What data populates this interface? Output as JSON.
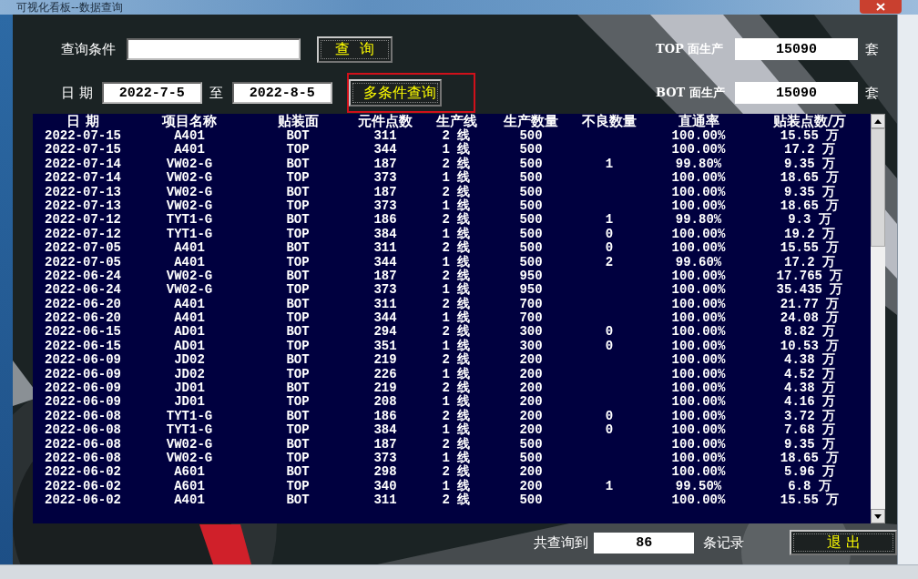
{
  "window": {
    "title": "可视化看板--数据查询"
  },
  "query": {
    "label": "查询条件",
    "button": "查  询"
  },
  "date_range": {
    "label": "日 期",
    "from": "2022-7-5",
    "separator": "至",
    "to": "2022-8-5",
    "button": "多条件查询"
  },
  "production": [
    {
      "label": "TOP 面生产",
      "value": "15090",
      "unit": "套"
    },
    {
      "label": "BOT 面生产",
      "value": "15090",
      "unit": "套"
    }
  ],
  "table": {
    "columns": [
      "日 期",
      "项目名称",
      "贴装面",
      "元件点数",
      "生产线",
      "生产数量",
      "不良数量",
      "直通率",
      "贴装点数/万"
    ],
    "rows": [
      {
        "date": "2022-07-15",
        "project": "A401",
        "face": "BOT",
        "points": "311",
        "line": "2 线",
        "qty": "500",
        "rate": "100.00%",
        "smt": "15.55 万"
      },
      {
        "date": "2022-07-15",
        "project": "A401",
        "face": "TOP",
        "points": "344",
        "line": "1 线",
        "qty": "500",
        "rate": "100.00%",
        "smt": "17.2 万"
      },
      {
        "date": "2022-07-14",
        "project": "VW02-G",
        "face": "BOT",
        "points": "187",
        "line": "2 线",
        "qty": "500",
        "defects": "1",
        "rate": "99.80%",
        "smt": "9.35 万"
      },
      {
        "date": "2022-07-14",
        "project": "VW02-G",
        "face": "TOP",
        "points": "373",
        "line": "1 线",
        "qty": "500",
        "rate": "100.00%",
        "smt": "18.65 万"
      },
      {
        "date": "2022-07-13",
        "project": "VW02-G",
        "face": "BOT",
        "points": "187",
        "line": "2 线",
        "qty": "500",
        "rate": "100.00%",
        "smt": "9.35 万"
      },
      {
        "date": "2022-07-13",
        "project": "VW02-G",
        "face": "TOP",
        "points": "373",
        "line": "1 线",
        "qty": "500",
        "rate": "100.00%",
        "smt": "18.65 万"
      },
      {
        "date": "2022-07-12",
        "project": "TYT1-G",
        "face": "BOT",
        "points": "186",
        "line": "2 线",
        "qty": "500",
        "defects": "1",
        "rate": "99.80%",
        "smt": "9.3 万"
      },
      {
        "date": "2022-07-12",
        "project": "TYT1-G",
        "face": "TOP",
        "points": "384",
        "line": "1 线",
        "qty": "500",
        "defects": "0",
        "rate": "100.00%",
        "smt": "19.2 万"
      },
      {
        "date": "2022-07-05",
        "project": "A401",
        "face": "BOT",
        "points": "311",
        "line": "2 线",
        "qty": "500",
        "defects": "0",
        "rate": "100.00%",
        "smt": "15.55 万"
      },
      {
        "date": "2022-07-05",
        "project": "A401",
        "face": "TOP",
        "points": "344",
        "line": "1 线",
        "qty": "500",
        "defects": "2",
        "rate": "99.60%",
        "smt": "17.2 万"
      },
      {
        "date": "2022-06-24",
        "project": "VW02-G",
        "face": "BOT",
        "points": "187",
        "line": "2 线",
        "qty": "950",
        "rate": "100.00%",
        "smt": "17.765 万"
      },
      {
        "date": "2022-06-24",
        "project": "VW02-G",
        "face": "TOP",
        "points": "373",
        "line": "1 线",
        "qty": "950",
        "rate": "100.00%",
        "smt": "35.435 万"
      },
      {
        "date": "2022-06-20",
        "project": "A401",
        "face": "BOT",
        "points": "311",
        "line": "2 线",
        "qty": "700",
        "rate": "100.00%",
        "smt": "21.77 万"
      },
      {
        "date": "2022-06-20",
        "project": "A401",
        "face": "TOP",
        "points": "344",
        "line": "1 线",
        "qty": "700",
        "rate": "100.00%",
        "smt": "24.08 万"
      },
      {
        "date": "2022-06-15",
        "project": "AD01",
        "face": "BOT",
        "points": "294",
        "line": "2 线",
        "qty": "300",
        "defects": "0",
        "rate": "100.00%",
        "smt": "8.82 万"
      },
      {
        "date": "2022-06-15",
        "project": "AD01",
        "face": "TOP",
        "points": "351",
        "line": "1 线",
        "qty": "300",
        "defects": "0",
        "rate": "100.00%",
        "smt": "10.53 万"
      },
      {
        "date": "2022-06-09",
        "project": "JD02",
        "face": "BOT",
        "points": "219",
        "line": "2 线",
        "qty": "200",
        "rate": "100.00%",
        "smt": "4.38 万"
      },
      {
        "date": "2022-06-09",
        "project": "JD02",
        "face": "TOP",
        "points": "226",
        "line": "1 线",
        "qty": "200",
        "rate": "100.00%",
        "smt": "4.52 万"
      },
      {
        "date": "2022-06-09",
        "project": "JD01",
        "face": "BOT",
        "points": "219",
        "line": "2 线",
        "qty": "200",
        "rate": "100.00%",
        "smt": "4.38 万"
      },
      {
        "date": "2022-06-09",
        "project": "JD01",
        "face": "TOP",
        "points": "208",
        "line": "1 线",
        "qty": "200",
        "rate": "100.00%",
        "smt": "4.16 万"
      },
      {
        "date": "2022-06-08",
        "project": "TYT1-G",
        "face": "BOT",
        "points": "186",
        "line": "2 线",
        "qty": "200",
        "defects": "0",
        "rate": "100.00%",
        "smt": "3.72 万"
      },
      {
        "date": "2022-06-08",
        "project": "TYT1-G",
        "face": "TOP",
        "points": "384",
        "line": "1 线",
        "qty": "200",
        "defects": "0",
        "rate": "100.00%",
        "smt": "7.68 万"
      },
      {
        "date": "2022-06-08",
        "project": "VW02-G",
        "face": "BOT",
        "points": "187",
        "line": "2 线",
        "qty": "500",
        "rate": "100.00%",
        "smt": "9.35 万"
      },
      {
        "date": "2022-06-08",
        "project": "VW02-G",
        "face": "TOP",
        "points": "373",
        "line": "1 线",
        "qty": "500",
        "rate": "100.00%",
        "smt": "18.65 万"
      },
      {
        "date": "2022-06-02",
        "project": "A601",
        "face": "BOT",
        "points": "298",
        "line": "2 线",
        "qty": "200",
        "rate": "100.00%",
        "smt": "5.96 万"
      },
      {
        "date": "2022-06-02",
        "project": "A601",
        "face": "TOP",
        "points": "340",
        "line": "1 线",
        "qty": "200",
        "defects": "1",
        "rate": "99.50%",
        "smt": "6.8 万"
      },
      {
        "date": "2022-06-02",
        "project": "A401",
        "face": "BOT",
        "points": "311",
        "line": "2 线",
        "qty": "500",
        "rate": "100.00%",
        "smt": "15.55 万"
      }
    ]
  },
  "footer": {
    "label": "共查询到",
    "count": "86",
    "unit": "条记录",
    "exit_button": "退 出"
  }
}
